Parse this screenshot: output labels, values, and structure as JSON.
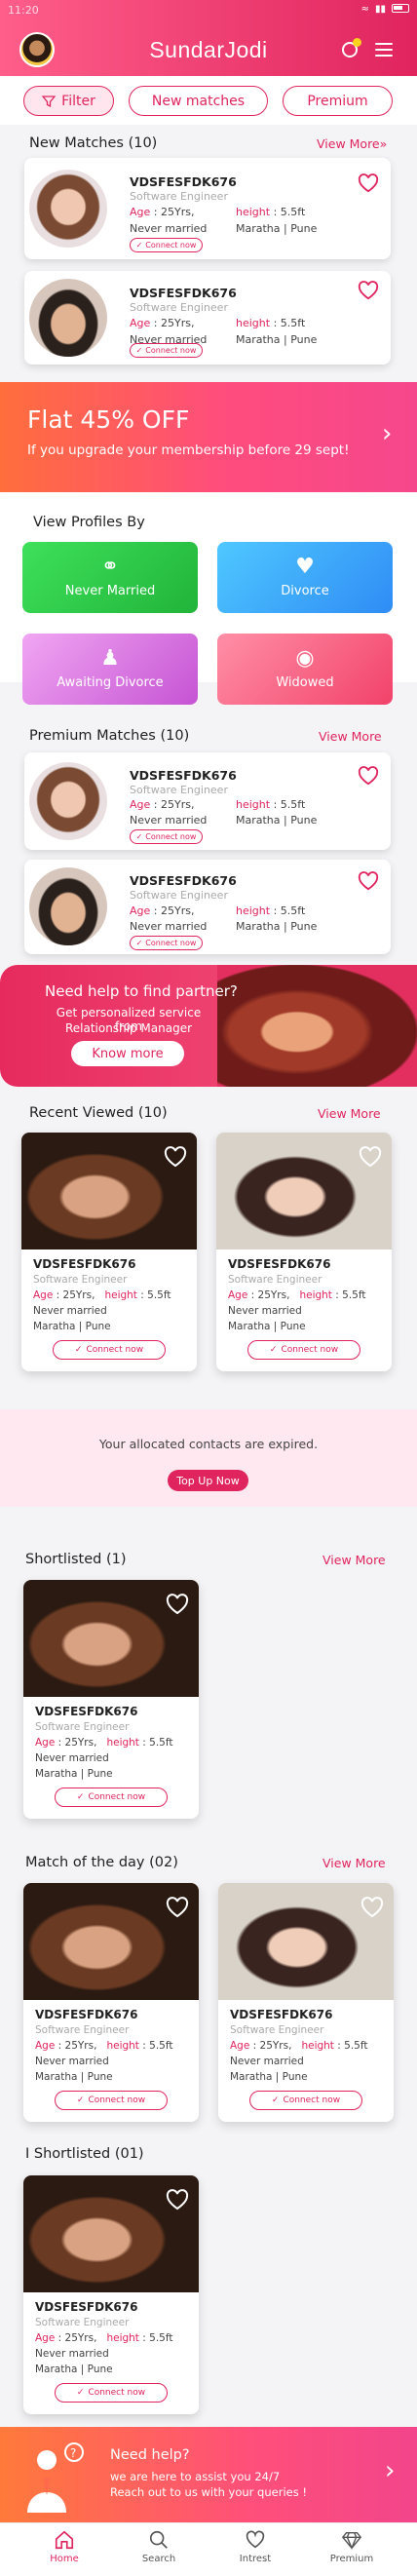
{
  "status": {
    "time": "11:20"
  },
  "header": {
    "title": "SundarJodi"
  },
  "filters": {
    "filter": "Filter",
    "new_matches": "New matches",
    "premium": "Premium"
  },
  "new_matches": {
    "title": "New Matches (10)",
    "view_more": "View More",
    "items": [
      {
        "id": "VDSFESFDK676",
        "profession": "Software Engineer",
        "age_label": "Age",
        "age": ": 25Yrs,",
        "height_label": "height",
        "height": ": 5.5ft",
        "status": "Never married",
        "community": "Maratha",
        "city": "Pune",
        "connect": "Connect now"
      },
      {
        "id": "VDSFESFDK676",
        "profession": "Software Engineer",
        "age_label": "Age",
        "age": ": 25Yrs,",
        "height_label": "height",
        "height": ": 5.5ft",
        "status": "Never married",
        "community": "Maratha",
        "city": "Pune",
        "connect": "Connect now"
      }
    ]
  },
  "promo": {
    "headline": "Flat 45% OFF",
    "sub": "If you upgrade your membership before 29 sept!"
  },
  "view_profiles": {
    "title": "View Profiles By",
    "items": [
      {
        "label": "Never Married",
        "color_from": "#3ee05a",
        "color_to": "#21b43a"
      },
      {
        "label": "Divorce",
        "color_from": "#4fc8ff",
        "color_to": "#2f8cf5"
      },
      {
        "label": "Awaiting Divorce",
        "color_from": "#f0a6f2",
        "color_to": "#c653d4"
      },
      {
        "label": "Widowed",
        "color_from": "#ff8fa6",
        "color_to": "#f2426a"
      }
    ]
  },
  "premium_matches": {
    "title": "Premium Matches (10)",
    "view_more": "View More",
    "items": [
      {
        "id": "VDSFESFDK676",
        "profession": "Software Engineer",
        "age_label": "Age",
        "age": ": 25Yrs,",
        "height_label": "height",
        "height": ": 5.5ft",
        "status": "Never married",
        "community": "Maratha",
        "city": "Pune",
        "connect": "Connect now"
      },
      {
        "id": "VDSFESFDK676",
        "profession": "Software Engineer",
        "age_label": "Age",
        "age": ": 25Yrs,",
        "height_label": "height",
        "height": ": 5.5ft",
        "status": "Never married",
        "community": "Maratha",
        "city": "Pune",
        "connect": "Connect now"
      }
    ]
  },
  "help_banner": {
    "title": "Need help to find partner?",
    "line1": "Get personalized service from",
    "line2": "Relationship Manager",
    "button": "Know more"
  },
  "recent_viewed": {
    "title": "Recent Viewed (10)",
    "view_more": "View More",
    "items": [
      {
        "id": "VDSFESFDK676",
        "profession": "Software Engineer",
        "age_label": "Age",
        "age": ": 25Yrs,",
        "height_label": "height",
        "height": ": 5.5ft",
        "status": "Never married",
        "community": "Maratha",
        "city": "Pune",
        "connect": "Connect now"
      },
      {
        "id": "VDSFESFDK676",
        "profession": "Software Engineer",
        "age_label": "Age",
        "age": ": 25Yrs,",
        "height_label": "height",
        "height": ": 5.5ft",
        "status": "Never married",
        "community": "Maratha",
        "city": "Pune",
        "connect": "Connect now"
      }
    ]
  },
  "expired": {
    "message": "Your allocated contacts are expired.",
    "button": "Top Up Now"
  },
  "shortlisted": {
    "title": "Shortlisted (1)",
    "view_more": "View More",
    "item": {
      "id": "VDSFESFDK676",
      "profession": "Software Engineer",
      "age_label": "Age",
      "age": ": 25Yrs,",
      "height_label": "height",
      "height": ": 5.5ft",
      "status": "Never married",
      "community": "Maratha",
      "city": "Pune",
      "connect": "Connect now"
    }
  },
  "match_of_day": {
    "title": "Match of the day (02)",
    "view_more": "View More",
    "items": [
      {
        "id": "VDSFESFDK676",
        "profession": "Software Engineer",
        "age_label": "Age",
        "age": ": 25Yrs,",
        "height_label": "height",
        "height": ": 5.5ft",
        "status": "Never married",
        "community": "Maratha",
        "city": "Pune",
        "connect": "Connect now"
      },
      {
        "id": "VDSFESFDK676",
        "profession": "Software Engineer",
        "age_label": "Age",
        "age": ": 25Yrs,",
        "height_label": "height",
        "height": ": 5.5ft",
        "status": "Never married",
        "community": "Maratha",
        "city": "Pune",
        "connect": "Connect now"
      }
    ]
  },
  "i_shortlisted": {
    "title": "I Shortlisted (01)",
    "item": {
      "id": "VDSFESFDK676",
      "profession": "Software Engineer",
      "age_label": "Age",
      "age": ": 25Yrs,",
      "height_label": "height",
      "height": ": 5.5ft",
      "status": "Never married",
      "community": "Maratha",
      "city": "Pune",
      "connect": "Connect now"
    }
  },
  "need_help": {
    "title": "Need help?",
    "line1": "we are here to assist you 24/7",
    "line2": "Reach out to us with your queries !"
  },
  "bottom_nav": {
    "home": "Home",
    "search": "Search",
    "interest": "Intrest",
    "premium": "Premium"
  },
  "colors": {
    "accent": "#e0245e"
  }
}
